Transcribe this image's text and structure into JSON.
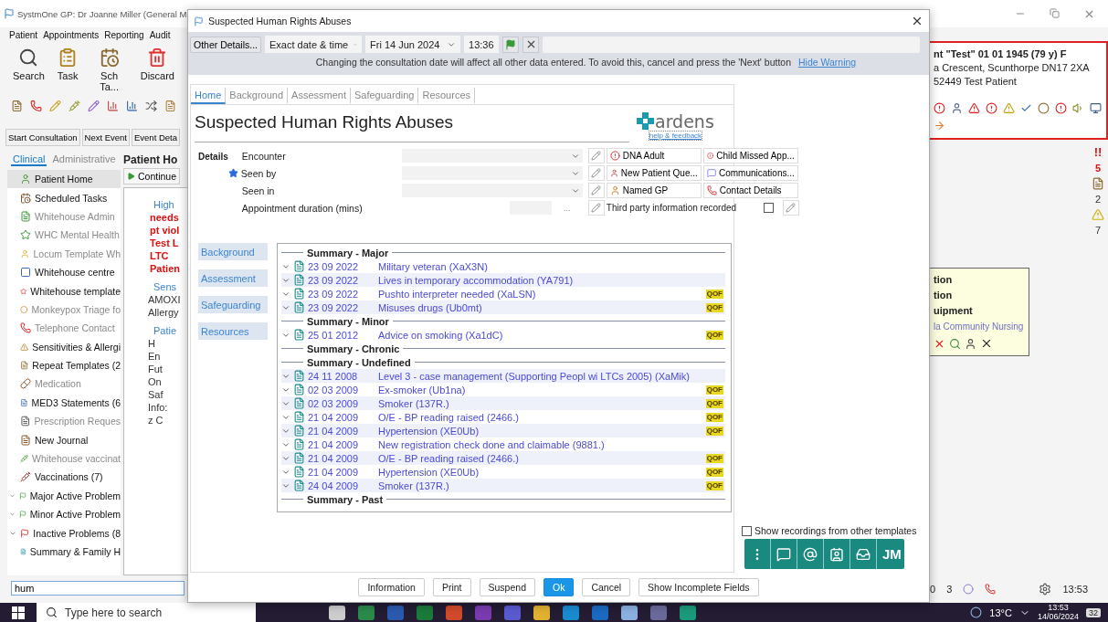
{
  "app": {
    "title": "SystmOne GP: Dr Joanne Miller (General M",
    "menu": [
      "Patient",
      "Appointments",
      "Reporting",
      "Audit"
    ],
    "toolbar": [
      "Search",
      "Task",
      "Sch Ta...",
      "Discard"
    ],
    "event_buttons": [
      "Start Consultation",
      "Next Event",
      "Event Deta"
    ],
    "tabs": [
      {
        "label": "Clinical",
        "selected": true
      },
      {
        "label": "Administrative",
        "selected": false
      }
    ],
    "nav": [
      {
        "label": "Patient Home",
        "kind": "item",
        "greyed": false,
        "selected": true
      },
      {
        "label": "Scheduled Tasks",
        "kind": "item",
        "greyed": false,
        "selected": false
      },
      {
        "label": "Whitehouse Admin",
        "kind": "item",
        "greyed": true,
        "selected": false
      },
      {
        "label": "WHC Mental Health",
        "kind": "item",
        "greyed": true,
        "selected": false
      },
      {
        "label": "Locum Template Wh",
        "kind": "item",
        "greyed": true,
        "selected": false
      },
      {
        "label": "Whitehouse centre",
        "kind": "item",
        "greyed": false,
        "selected": false
      },
      {
        "label": "Whitehouse template",
        "kind": "item",
        "greyed": false,
        "selected": false
      },
      {
        "label": "Monkeypox Triage fo",
        "kind": "item",
        "greyed": true,
        "selected": false
      },
      {
        "label": "Telephone Contact",
        "kind": "item",
        "greyed": true,
        "selected": false
      },
      {
        "label": "Sensitivities & Allergi",
        "kind": "item",
        "greyed": false,
        "selected": false
      },
      {
        "label": "Repeat Templates (2",
        "kind": "item",
        "greyed": false,
        "selected": false
      },
      {
        "label": "Medication",
        "kind": "item",
        "greyed": true,
        "selected": false
      },
      {
        "label": "MED3 Statements (6",
        "kind": "item",
        "greyed": false,
        "selected": false
      },
      {
        "label": "Prescription Reques",
        "kind": "item",
        "greyed": true,
        "selected": false
      },
      {
        "label": "New Journal",
        "kind": "item",
        "greyed": false,
        "selected": false
      },
      {
        "label": "Whitehouse vaccinat",
        "kind": "item",
        "greyed": true,
        "selected": false
      },
      {
        "label": "Vaccinations (7)",
        "kind": "item",
        "greyed": false,
        "selected": false
      },
      {
        "label": "Major Active Problem",
        "kind": "group",
        "greyed": false,
        "selected": false
      },
      {
        "label": "Minor Active Problem",
        "kind": "group",
        "greyed": false,
        "selected": false
      },
      {
        "label": "Inactive Problems (8",
        "kind": "group",
        "greyed": false,
        "selected": false
      },
      {
        "label": "Summary & Family H",
        "kind": "item",
        "greyed": false,
        "selected": false
      }
    ],
    "search": {
      "value": "hum"
    },
    "patient_home": {
      "title": "Patient Ho",
      "continue": "Continue",
      "groups": [
        {
          "heading": "High",
          "alert": true,
          "lines": [
            "needs",
            "pt viol",
            "Test L",
            "LTC",
            "Patien"
          ]
        },
        {
          "heading": "Sens",
          "alert": false,
          "lines": [
            "AMOXI",
            "Allergy"
          ]
        },
        {
          "heading": "Patie",
          "alert": false,
          "lines": [
            "H",
            "En",
            "Fut",
            "On",
            "Saf",
            "Info:",
            "z C"
          ]
        }
      ]
    },
    "banner": [
      "nt \"Test\" 01 01 1945 (79 y) F",
      "a Crescent, Scunthorpe DN17 2XA",
      "52449   Test Patient"
    ],
    "counters": [
      {
        "kind": "text",
        "mark": "!!",
        "count": "5"
      },
      {
        "kind": "icon",
        "count": "2"
      },
      {
        "kind": "warning",
        "count": "7"
      }
    ],
    "note": {
      "lines": [
        "tion",
        "tion",
        "uipment"
      ],
      "link": "la Community Nursing"
    },
    "status": [
      "0",
      "3"
    ],
    "clock": "13:53"
  },
  "dialog": {
    "title": "Suspected Human Rights Abuses",
    "other_details": "Other Details...",
    "date_mode": "Exact date & time",
    "date": "Fri 14 Jun 2024",
    "time": "13:36",
    "warning": "Changing the consultation date will affect all other data entered. To avoid this, cancel and press the 'Next' button",
    "hide_warning": "Hide Warning",
    "tabs": [
      {
        "label": "Home",
        "selected": true
      },
      {
        "label": "Background",
        "selected": false
      },
      {
        "label": "Assessment",
        "selected": false
      },
      {
        "label": "Safeguarding",
        "selected": false
      },
      {
        "label": "Resources",
        "selected": false
      }
    ],
    "heading": "Suspected Human Rights Abuses",
    "logo": "ardens",
    "help_link": "help & feedback",
    "details_label": "Details",
    "fields": [
      {
        "label": "Encounter",
        "kind": "select",
        "starred": false
      },
      {
        "label": "Seen by",
        "kind": "select",
        "starred": true
      },
      {
        "label": "Seen in",
        "kind": "select",
        "starred": false
      },
      {
        "label": "Appointment duration (mins)",
        "kind": "number",
        "starred": false,
        "suffix": "..."
      }
    ],
    "actions": [
      "DNA Adult",
      "Child Missed App...",
      "New Patient Que...",
      "Communications...",
      "Named GP",
      "Contact Details"
    ],
    "third_party": {
      "label": "Third party information recorded",
      "checked": false
    },
    "side_nav": [
      "Background",
      "Assessment",
      "Safeguarding",
      "Resources"
    ],
    "sections": [
      {
        "title": "Summary - Major",
        "rows": [
          {
            "date": "23 09 2022",
            "text": "Military veteran (XaX3N)"
          },
          {
            "date": "23 09 2022",
            "text": "Lives in temporary accommodation (YA791)"
          },
          {
            "date": "23 09 2022",
            "text": "Pushto interpreter needed (XaLSN)",
            "badge": "QOF"
          },
          {
            "date": "23 09 2022",
            "text": "Misuses drugs (Ub0mt)",
            "badge": "QOF"
          }
        ]
      },
      {
        "title": "Summary - Minor",
        "rows": [
          {
            "date": "25 01 2012",
            "text": "Advice on smoking (Xa1dC)",
            "badge": "QOF"
          }
        ]
      },
      {
        "title": "Summary - Chronic"
      },
      {
        "title": "Summary - Undefined",
        "rows": [
          {
            "date": "24 11 2008",
            "text": "Level 3 - case management (Supporting Peopl wi LTCs 2005) (XaMik)"
          },
          {
            "date": "02 03 2009",
            "text": "Ex-smoker (Ub1na)",
            "badge": "QOF"
          },
          {
            "date": "02 03 2009",
            "text": "Smoker (137R.)",
            "badge": "QOF"
          },
          {
            "date": "21 04 2009",
            "text": "O/E - BP reading raised (2466.)",
            "badge": "QOF"
          },
          {
            "date": "21 04 2009",
            "text": "Hypertension (XE0Ub)",
            "badge": "QOF"
          },
          {
            "date": "21 04 2009",
            "text": "New registration check done and claimable (9881.)"
          },
          {
            "date": "21 04 2009",
            "text": "O/E - BP reading raised (2466.)",
            "badge": "QOF"
          },
          {
            "date": "21 04 2009",
            "text": "Hypertension (XE0Ub)",
            "badge": "QOF"
          },
          {
            "date": "24 04 2009",
            "text": "Smoker (137R.)",
            "badge": "QOF"
          }
        ]
      },
      {
        "title": "Summary - Past"
      }
    ],
    "show_other": {
      "label": "Show recordings from other templates",
      "checked": false
    },
    "floating_user": "JM",
    "buttons": [
      {
        "label": "Information",
        "primary": false
      },
      {
        "label": "Print",
        "primary": false
      },
      {
        "label": "Suspend",
        "primary": false
      },
      {
        "label": "Ok",
        "primary": true
      },
      {
        "label": "Cancel",
        "primary": false
      },
      {
        "label": "Show Incomplete Fields",
        "primary": false
      }
    ]
  },
  "taskbar": {
    "search_placeholder": "Type here to search",
    "weather": "13°C",
    "time": "13:53",
    "date": "14/06/2024",
    "notifications": "32"
  }
}
